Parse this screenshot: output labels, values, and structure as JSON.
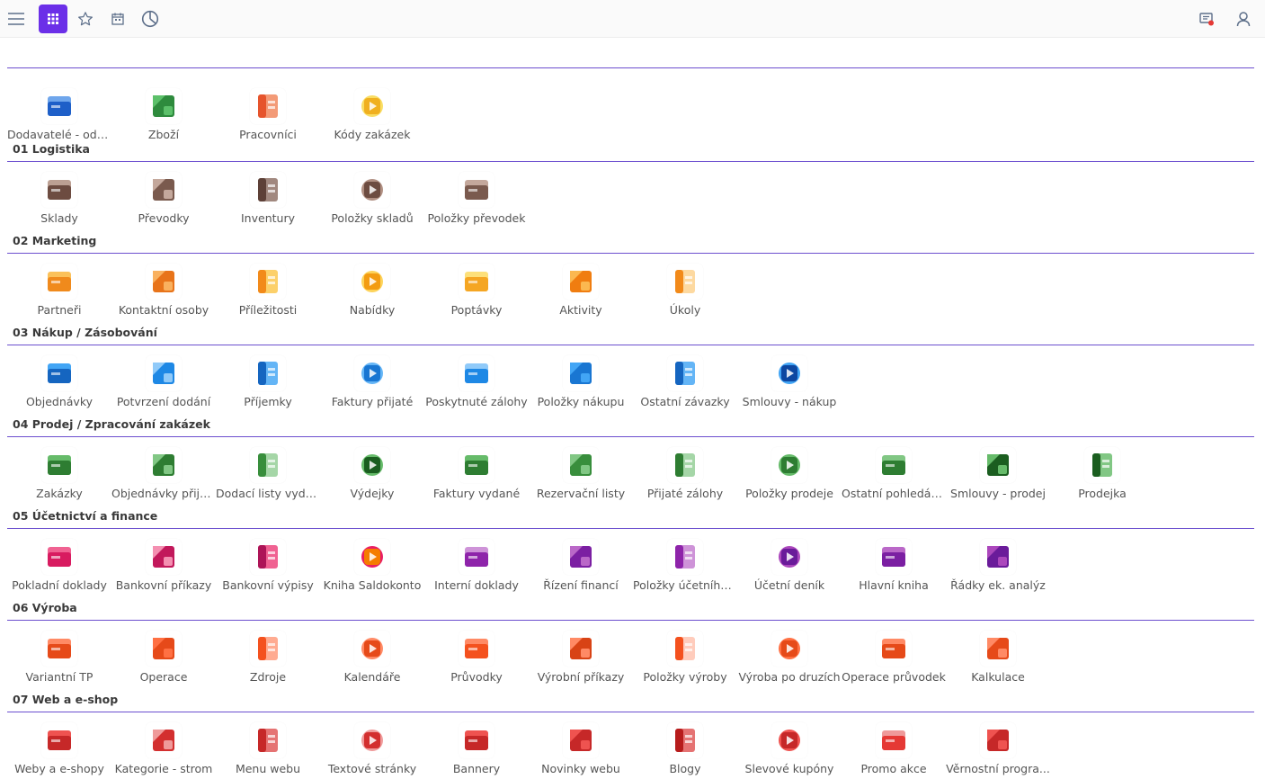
{
  "toolbar": {
    "menu_icon": "hamburger-menu-icon",
    "apps_icon": "apps-grid-icon",
    "favorites_icon": "star-icon",
    "calendar_icon": "calendar-icon",
    "history_icon": "clock-icon",
    "notifications_icon": "notification-icon",
    "user_icon": "user-icon",
    "active_color": "#6b2fe8"
  },
  "top_tiles": [
    {
      "label": "Dodavatelé - odb...",
      "icon": "partners-icon",
      "colors": [
        "#1e5fc8",
        "#6fa6ec"
      ]
    },
    {
      "label": "Zboží",
      "icon": "goods-icon",
      "colors": [
        "#2e8b3d",
        "#5cc06a"
      ]
    },
    {
      "label": "Pracovníci",
      "icon": "workers-icon",
      "colors": [
        "#e6542c",
        "#f39a77"
      ]
    },
    {
      "label": "Kódy zakázek",
      "icon": "order-codes-icon",
      "colors": [
        "#f0b020",
        "#f9dd63"
      ]
    }
  ],
  "sections": [
    {
      "title": "01 Logistika",
      "tiles": [
        {
          "label": "Sklady",
          "icon": "warehouse-icon",
          "colors": [
            "#6d4c41",
            "#bca093"
          ]
        },
        {
          "label": "Převodky",
          "icon": "transfer-icon",
          "colors": [
            "#7a5a4e",
            "#c4a89c"
          ]
        },
        {
          "label": "Inventury",
          "icon": "inventory-icon",
          "colors": [
            "#5d4037",
            "#a1887f"
          ]
        },
        {
          "label": "Položky skladů",
          "icon": "stock-items-icon",
          "colors": [
            "#6d4c41",
            "#b08f82"
          ]
        },
        {
          "label": "Položky převodek",
          "icon": "transfer-items-icon",
          "colors": [
            "#7a5a4e",
            "#c4a89c"
          ]
        }
      ]
    },
    {
      "title": "02 Marketing",
      "tiles": [
        {
          "label": "Partneři",
          "icon": "partners-orange-icon",
          "colors": [
            "#f08a1c",
            "#fbc15a"
          ]
        },
        {
          "label": "Kontaktní osoby",
          "icon": "contacts-icon",
          "colors": [
            "#e8741a",
            "#f9b15f"
          ]
        },
        {
          "label": "Příležitosti",
          "icon": "opportunity-icon",
          "colors": [
            "#f28a1a",
            "#fcd06a"
          ]
        },
        {
          "label": "Nabídky",
          "icon": "offers-icon",
          "colors": [
            "#f39c12",
            "#fdd35a"
          ]
        },
        {
          "label": "Poptávky",
          "icon": "requests-icon",
          "colors": [
            "#f5a623",
            "#fde07a"
          ]
        },
        {
          "label": "Aktivity",
          "icon": "activities-icon",
          "colors": [
            "#f07d10",
            "#fbb850"
          ]
        },
        {
          "label": "Úkoly",
          "icon": "tasks-icon",
          "colors": [
            "#f28a1a",
            "#fdd9a0"
          ]
        }
      ]
    },
    {
      "title": "03 Nákup / Zásobování",
      "tiles": [
        {
          "label": "Objednávky",
          "icon": "orders-icon",
          "colors": [
            "#1565c0",
            "#42a5f5"
          ]
        },
        {
          "label": "Potvrzení dodání",
          "icon": "delivery-confirm-icon",
          "colors": [
            "#1e88e5",
            "#90caf9"
          ]
        },
        {
          "label": "Příjemky",
          "icon": "receipts-icon",
          "colors": [
            "#1565c0",
            "#64b5f6"
          ]
        },
        {
          "label": "Faktury přijaté",
          "icon": "received-invoices-icon",
          "colors": [
            "#1976d2",
            "#64b5f6"
          ]
        },
        {
          "label": "Poskytnuté zálohy",
          "icon": "advances-given-icon",
          "colors": [
            "#1e88e5",
            "#90caf9"
          ]
        },
        {
          "label": "Položky nákupu",
          "icon": "purchase-items-icon",
          "colors": [
            "#1976d2",
            "#42a5f5"
          ]
        },
        {
          "label": "Ostatní závazky",
          "icon": "liabilities-icon",
          "colors": [
            "#1565c0",
            "#64b5f6"
          ]
        },
        {
          "label": "Smlouvy - nákup",
          "icon": "purchase-contracts-icon",
          "colors": [
            "#0d47a1",
            "#42a5f5"
          ]
        }
      ]
    },
    {
      "title": "04 Prodej / Zpracování zakázek",
      "tiles": [
        {
          "label": "Zakázky",
          "icon": "jobs-icon",
          "colors": [
            "#2e7d32",
            "#66bb6a"
          ]
        },
        {
          "label": "Objednávky přijaté",
          "icon": "received-orders-icon",
          "colors": [
            "#2e7d32",
            "#81c784"
          ]
        },
        {
          "label": "Dodací listy vyda...",
          "icon": "delivery-notes-icon",
          "colors": [
            "#388e3c",
            "#a5d6a7"
          ]
        },
        {
          "label": "Výdejky",
          "icon": "issues-icon",
          "colors": [
            "#1b5e20",
            "#66bb6a"
          ]
        },
        {
          "label": "Faktury vydané",
          "icon": "issued-invoices-icon",
          "colors": [
            "#2e7d32",
            "#66bb6a"
          ]
        },
        {
          "label": "Rezervační listy",
          "icon": "reservations-icon",
          "colors": [
            "#388e3c",
            "#81c784"
          ]
        },
        {
          "label": "Přijaté zálohy",
          "icon": "advances-received-icon",
          "colors": [
            "#2e7d32",
            "#a5d6a7"
          ]
        },
        {
          "label": "Položky prodeje",
          "icon": "sales-items-icon",
          "colors": [
            "#2e7d32",
            "#66bb6a"
          ]
        },
        {
          "label": "Ostatní pohledáv...",
          "icon": "receivables-icon",
          "colors": [
            "#2e7d32",
            "#81c784"
          ]
        },
        {
          "label": "Smlouvy - prodej",
          "icon": "sales-contracts-icon",
          "colors": [
            "#1b5e20",
            "#66bb6a"
          ]
        },
        {
          "label": "Prodejka",
          "icon": "sale-slip-icon",
          "colors": [
            "#1b5e20",
            "#81c784"
          ]
        }
      ]
    },
    {
      "title": "05 Účetnictví a finance",
      "tiles": [
        {
          "label": "Pokladní doklady",
          "icon": "cash-docs-icon",
          "colors": [
            "#d81b60",
            "#f06292"
          ]
        },
        {
          "label": "Bankovní příkazy",
          "icon": "bank-orders-icon",
          "colors": [
            "#c2185b",
            "#f48fb1"
          ]
        },
        {
          "label": "Bankovní výpisy",
          "icon": "bank-statements-icon",
          "colors": [
            "#ad1457",
            "#f06292"
          ]
        },
        {
          "label": "Kniha Saldokonto",
          "icon": "ledger-book-icon",
          "colors": [
            "#f57c00",
            "#e91e63"
          ]
        },
        {
          "label": "Interní doklady",
          "icon": "internal-docs-icon",
          "colors": [
            "#8e24aa",
            "#ce93d8"
          ]
        },
        {
          "label": "Řízení financí",
          "icon": "finance-mgmt-icon",
          "colors": [
            "#7b1fa2",
            "#ba68c8"
          ]
        },
        {
          "label": "Položky účetního...",
          "icon": "accounting-items-icon",
          "colors": [
            "#8e24aa",
            "#ce93d8"
          ]
        },
        {
          "label": "Účetní deník",
          "icon": "journal-icon",
          "colors": [
            "#6a1b9a",
            "#ab47bc"
          ]
        },
        {
          "label": "Hlavní kniha",
          "icon": "general-ledger-icon",
          "colors": [
            "#7b1fa2",
            "#ba68c8"
          ]
        },
        {
          "label": "Řádky ek. analýz",
          "icon": "analysis-rows-icon",
          "colors": [
            "#6a1b9a",
            "#ab47bc"
          ]
        }
      ]
    },
    {
      "title": "06 Výroba",
      "tiles": [
        {
          "label": "Variantní TP",
          "icon": "variant-tp-icon",
          "colors": [
            "#e64a19",
            "#ff8a65"
          ]
        },
        {
          "label": "Operace",
          "icon": "operations-icon",
          "colors": [
            "#e64a19",
            "#ff7043"
          ]
        },
        {
          "label": "Zdroje",
          "icon": "resources-icon",
          "colors": [
            "#f4511e",
            "#ffab91"
          ]
        },
        {
          "label": "Kalendáře",
          "icon": "calendars-icon",
          "colors": [
            "#e64a19",
            "#ff8a65"
          ]
        },
        {
          "label": "Průvodky",
          "icon": "job-cards-icon",
          "colors": [
            "#f4511e",
            "#ff8a65"
          ]
        },
        {
          "label": "Výrobní příkazy",
          "icon": "production-orders-icon",
          "colors": [
            "#d84315",
            "#ff8a65"
          ]
        },
        {
          "label": "Položky výroby",
          "icon": "production-items-icon",
          "colors": [
            "#f4511e",
            "#ffccbc"
          ]
        },
        {
          "label": "Výroba po druzích",
          "icon": "production-types-icon",
          "colors": [
            "#e64a19",
            "#ff7043"
          ]
        },
        {
          "label": "Operace průvodek",
          "icon": "job-operations-icon",
          "colors": [
            "#e64a19",
            "#ff8a65"
          ]
        },
        {
          "label": "Kalkulace",
          "icon": "calculation-icon",
          "colors": [
            "#e64a19",
            "#ff8a65"
          ]
        }
      ]
    },
    {
      "title": "07 Web a e-shop",
      "tiles": [
        {
          "label": "Weby a e-shopy",
          "icon": "websites-icon",
          "colors": [
            "#c62828",
            "#ef5350"
          ]
        },
        {
          "label": "Kategorie - strom",
          "icon": "category-tree-icon",
          "colors": [
            "#d32f2f",
            "#ef9a9a"
          ]
        },
        {
          "label": "Menu webu",
          "icon": "web-menu-icon",
          "colors": [
            "#c62828",
            "#e57373"
          ]
        },
        {
          "label": "Textové stránky",
          "icon": "text-pages-icon",
          "colors": [
            "#d32f2f",
            "#ef9a9a"
          ]
        },
        {
          "label": "Bannery",
          "icon": "banners-icon",
          "colors": [
            "#c62828",
            "#ef5350"
          ]
        },
        {
          "label": "Novinky webu",
          "icon": "news-icon",
          "colors": [
            "#c62828",
            "#ef5350"
          ]
        },
        {
          "label": "Blogy",
          "icon": "blogs-icon",
          "colors": [
            "#b71c1c",
            "#e57373"
          ]
        },
        {
          "label": "Slevové kupóny",
          "icon": "coupons-icon",
          "colors": [
            "#c62828",
            "#ef5350"
          ]
        },
        {
          "label": "Promo akce",
          "icon": "promo-icon",
          "colors": [
            "#e53935",
            "#ef9a9a"
          ]
        },
        {
          "label": "Věrnostní progra...",
          "icon": "loyalty-icon",
          "colors": [
            "#c62828",
            "#ef5350"
          ]
        }
      ]
    }
  ]
}
